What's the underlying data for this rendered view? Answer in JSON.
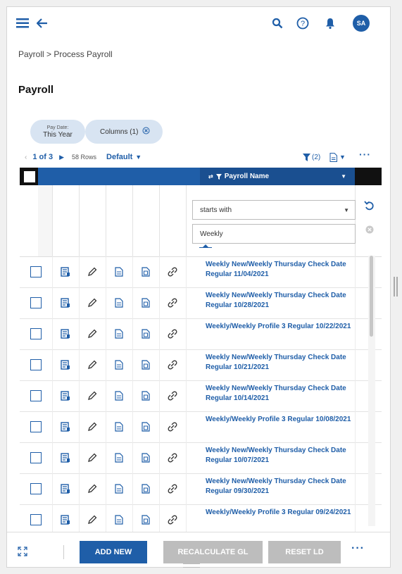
{
  "topbar": {
    "avatar_initials": "SA"
  },
  "breadcrumb": "Payroll > Process Payroll",
  "page_title": "Payroll",
  "chips": {
    "pay_date_label": "Pay Date:",
    "pay_date_value": "This Year",
    "columns_label": "Columns (1)"
  },
  "pager": {
    "page_info": "1 of 3",
    "rows": "58 Rows",
    "view": "Default",
    "filter_count": "(2)"
  },
  "grid": {
    "column_header": "Payroll Name",
    "filter_operator": "starts with",
    "filter_value": "Weekly",
    "rows": [
      {
        "name": "Weekly New/Weekly Thursday Check Date Regular 11/04/2021"
      },
      {
        "name": "Weekly New/Weekly Thursday Check Date Regular 10/28/2021"
      },
      {
        "name": "Weekly/Weekly Profile 3 Regular 10/22/2021"
      },
      {
        "name": "Weekly New/Weekly Thursday Check Date Regular 10/21/2021"
      },
      {
        "name": "Weekly New/Weekly Thursday Check Date Regular 10/14/2021"
      },
      {
        "name": "Weekly/Weekly Profile 3 Regular 10/08/2021"
      },
      {
        "name": "Weekly New/Weekly Thursday Check Date Regular 10/07/2021"
      },
      {
        "name": "Weekly New/Weekly Thursday Check Date Regular 09/30/2021"
      },
      {
        "name": "Weekly/Weekly Profile 3 Regular 09/24/2021"
      }
    ]
  },
  "footer": {
    "add_new": "ADD NEW",
    "recalculate": "RECALCULATE GL",
    "reset": "RESET LD"
  },
  "colors": {
    "primary": "#1f5ea8",
    "disabled": "#bdbdbd"
  }
}
